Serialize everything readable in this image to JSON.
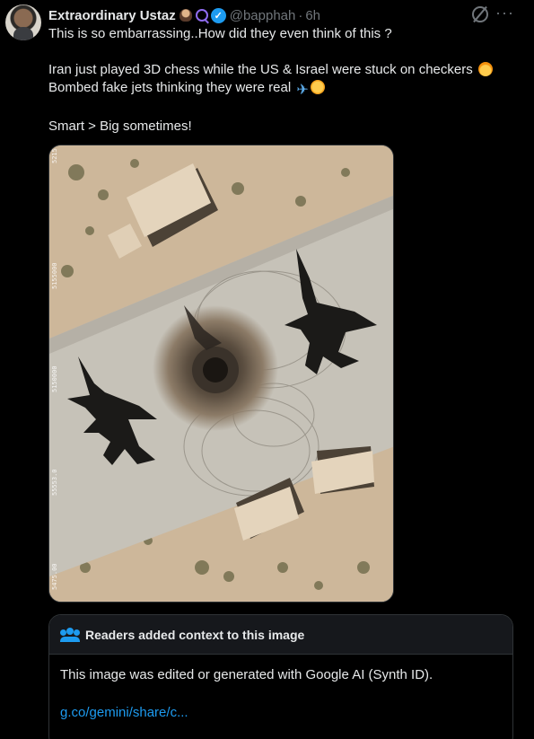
{
  "author": {
    "name": "Extraordinary Ustaz",
    "handle": "@bapphah",
    "separator": "·",
    "time": "6h"
  },
  "tweet": {
    "line1": "This is so embarrassing..How did they even think of this ?",
    "line2": "Iran just played 3D chess while the US & Israel were stuck on checkers",
    "line3": "Bombed fake jets thinking they were real",
    "line4": "Smart > Big sometimes!"
  },
  "media": {
    "coord_labels": [
      "5215",
      "5155000",
      "5150000",
      "55553.0",
      "5475.00"
    ]
  },
  "community_note": {
    "title": "Readers added context to this image",
    "body": "This image was edited or generated with Google AI (Synth ID).",
    "link": "g.co/gemini/share/c..."
  },
  "icons": {
    "verified": "verified-badge-icon",
    "grok": "grok-icon",
    "more": "more-icon",
    "notes": "people-icon"
  },
  "colors": {
    "accent": "#1d9bf0",
    "muted": "#71767b",
    "text": "#e7e9ea"
  }
}
